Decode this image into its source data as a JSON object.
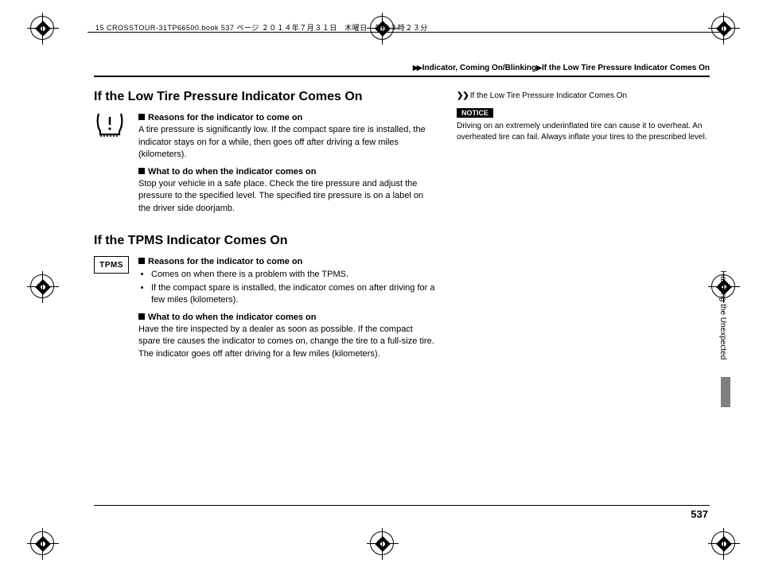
{
  "header": {
    "line": "15 CROSSTOUR-31TP66500.book  537 ページ  ２０１４年７月３１日　木曜日　午後３時２３分"
  },
  "breadcrumb": {
    "seg1": "Indicator, Coming On/Blinking",
    "seg2": "If the Low Tire Pressure Indicator Comes On"
  },
  "left": {
    "h1": "If the Low Tire Pressure Indicator Comes On",
    "s1a_head": "Reasons for the indicator to come on",
    "s1a_body": "A tire pressure is significantly low. If the compact spare tire is installed, the indicator stays on for a while, then goes off after driving a few miles (kilometers).",
    "s1b_head": "What to do when the indicator comes on",
    "s1b_body": "Stop your vehicle in a safe place. Check the tire pressure and adjust the pressure to the specified level. The specified tire pressure is on a label on the driver side doorjamb.",
    "h2": "If the TPMS Indicator Comes On",
    "tpms_label": "TPMS",
    "s2a_head": "Reasons for the indicator to come on",
    "s2a_b1": "Comes on when there is a problem with the TPMS.",
    "s2a_b2": "If the compact spare is installed, the indicator comes on after driving for a few miles (kilometers).",
    "s2b_head": "What to do when the indicator comes on",
    "s2b_body": "Have the tire inspected by a dealer as soon as possible. If the compact spare tire causes the indicator to comes on, change the tire to a full-size tire. The indicator goes off after driving for a few miles (kilometers)."
  },
  "right": {
    "ref": "If the Low Tire Pressure Indicator Comes On",
    "notice_label": "NOTICE",
    "notice_body": "Driving on an extremely underinflated tire can cause it to overheat. An overheated tire can fail. Always inflate your tires to the prescribed level."
  },
  "side_tab": "Handling the Unexpected",
  "page_number": "537"
}
